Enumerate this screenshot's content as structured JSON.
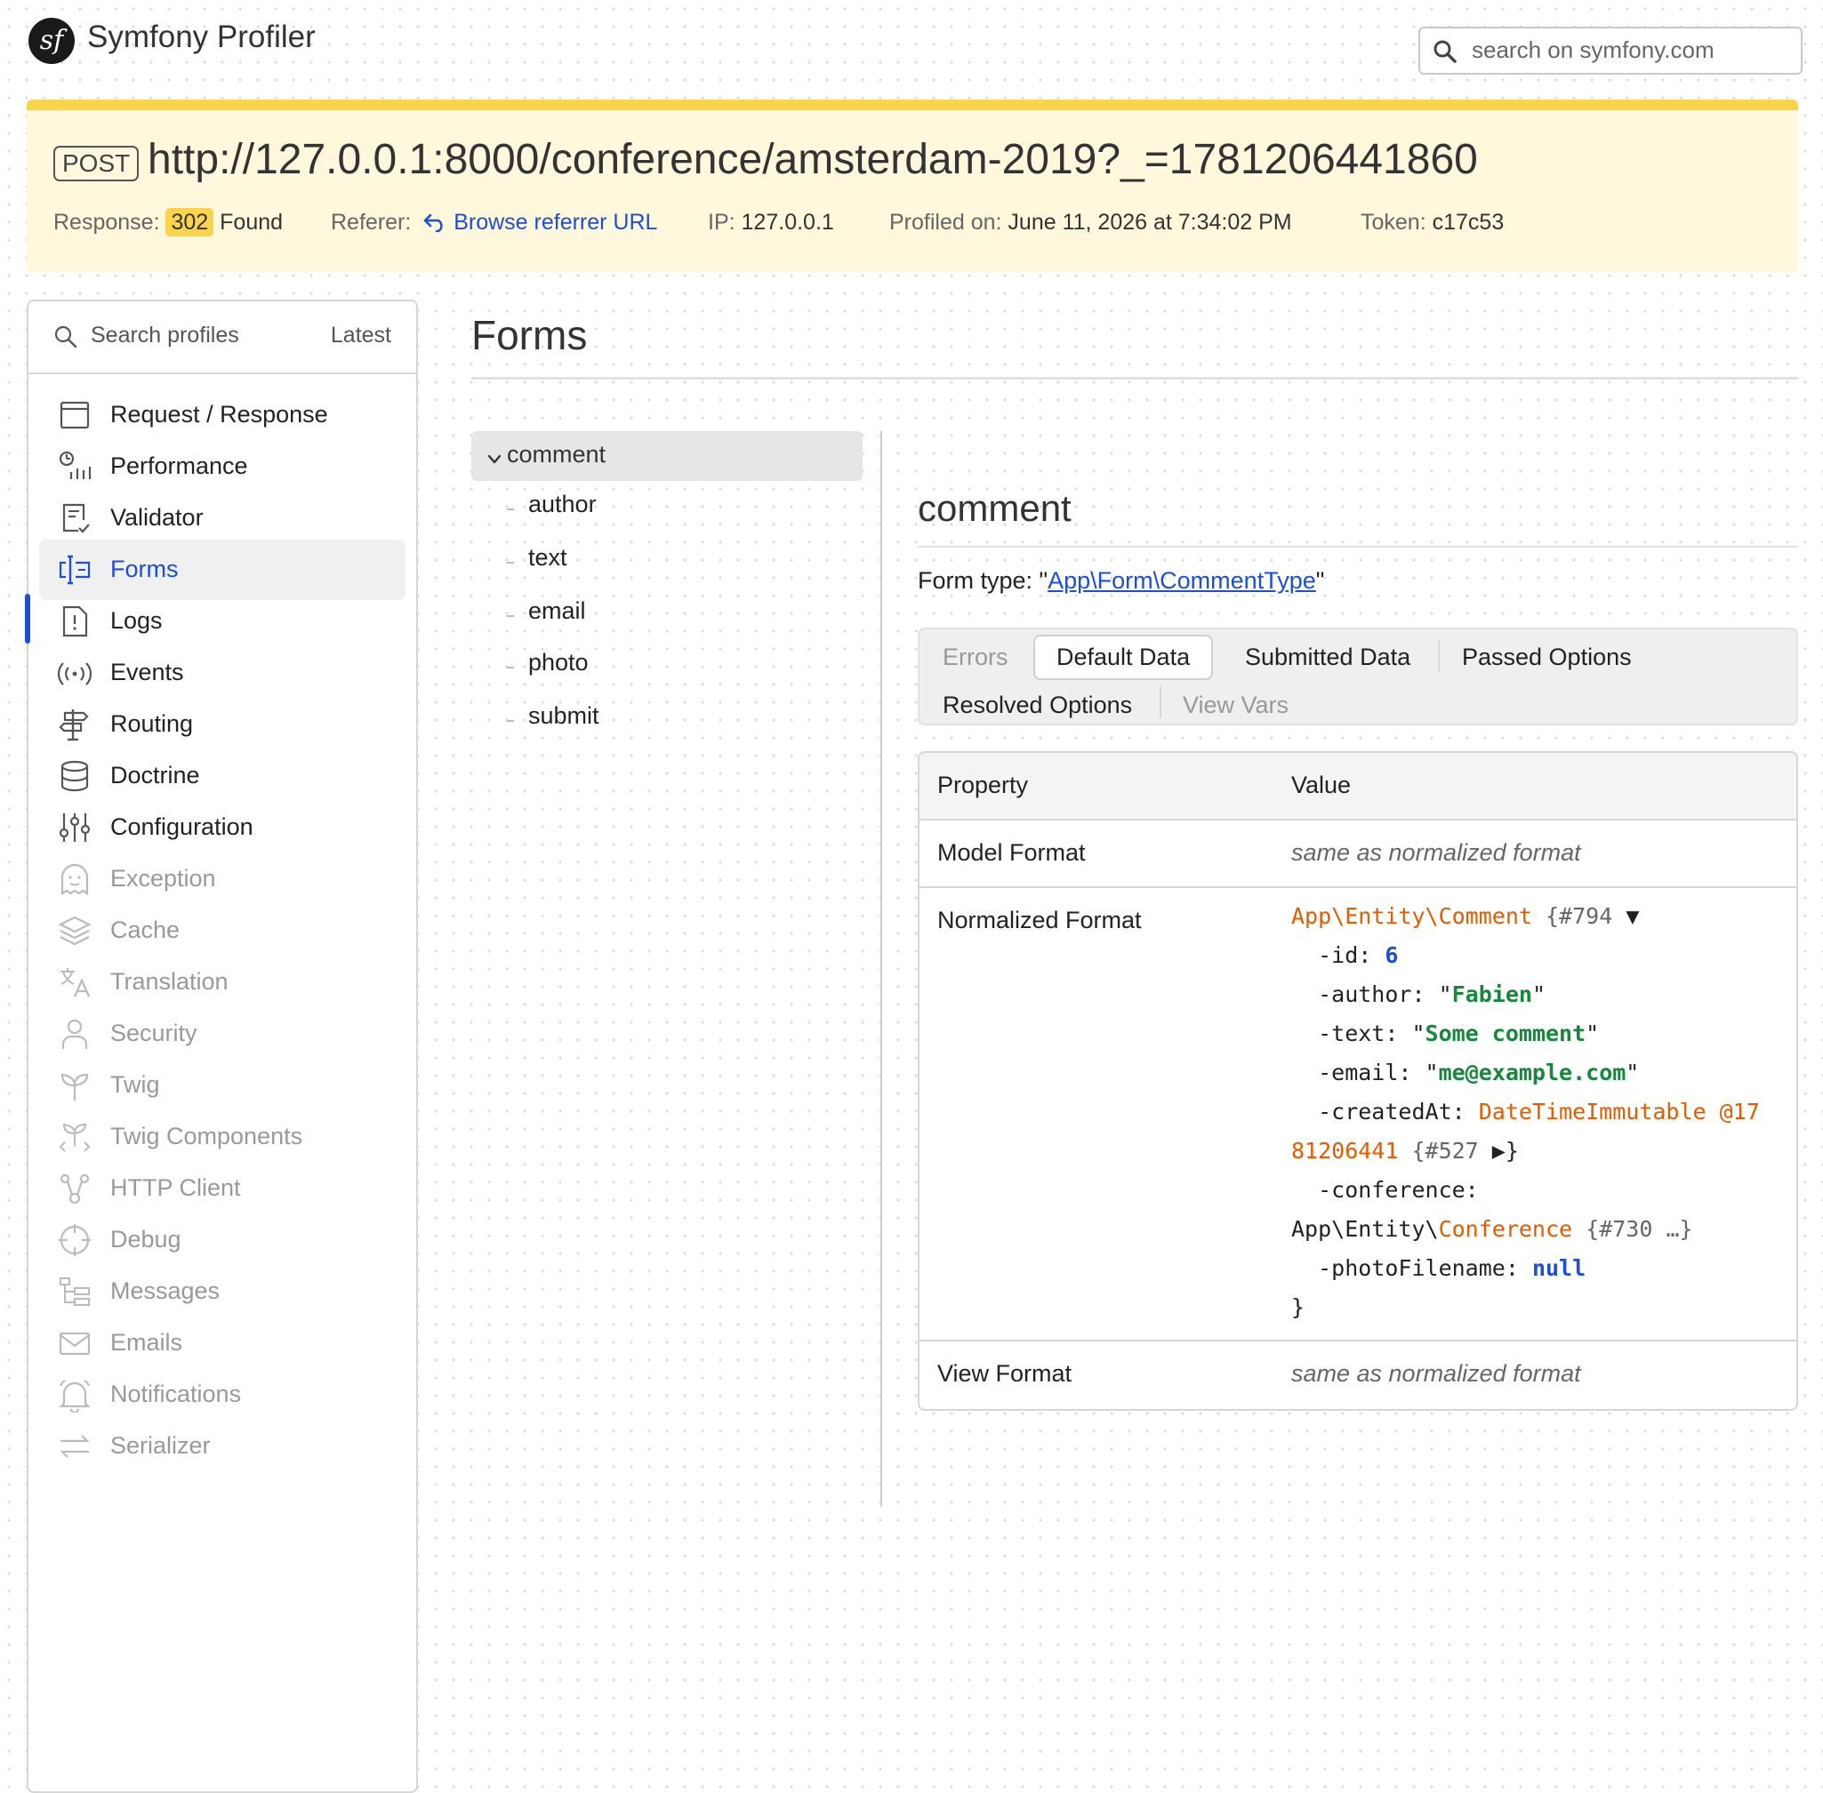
{
  "header": {
    "logo_text": "sf",
    "title": "Symfony Profiler",
    "search_placeholder": "search on symfony.com"
  },
  "summary": {
    "method": "POST",
    "url": "http://127.0.0.1:8000/conference/amsterdam-2019?_=1781206441860",
    "response_label": "Response:",
    "status_code": "302",
    "status_text": "Found",
    "referer_label": "Referer:",
    "referer_link": "Browse referrer URL",
    "ip_label": "IP:",
    "ip_value": "127.0.0.1",
    "profiled_label": "Profiled on:",
    "profiled_value": "June 11, 2026 at 7:34:02 PM",
    "token_label": "Token:",
    "token_value": "c17c53",
    "accent_color": "#fcd34d"
  },
  "sidebar": {
    "search_placeholder": "Search profiles",
    "latest_label": "Latest",
    "items": [
      {
        "label": "Request / Response",
        "icon": "window-icon",
        "state": "enabled"
      },
      {
        "label": "Performance",
        "icon": "performance-icon",
        "state": "enabled"
      },
      {
        "label": "Validator",
        "icon": "validator-icon",
        "state": "enabled"
      },
      {
        "label": "Forms",
        "icon": "forms-icon",
        "state": "active"
      },
      {
        "label": "Logs",
        "icon": "logs-icon",
        "state": "enabled"
      },
      {
        "label": "Events",
        "icon": "events-icon",
        "state": "enabled"
      },
      {
        "label": "Routing",
        "icon": "routing-icon",
        "state": "enabled"
      },
      {
        "label": "Doctrine",
        "icon": "database-icon",
        "state": "enabled"
      },
      {
        "label": "Configuration",
        "icon": "sliders-icon",
        "state": "enabled"
      },
      {
        "label": "Exception",
        "icon": "ghost-icon",
        "state": "disabled"
      },
      {
        "label": "Cache",
        "icon": "layers-icon",
        "state": "disabled"
      },
      {
        "label": "Translation",
        "icon": "translation-icon",
        "state": "disabled"
      },
      {
        "label": "Security",
        "icon": "user-icon",
        "state": "disabled"
      },
      {
        "label": "Twig",
        "icon": "twig-icon",
        "state": "disabled"
      },
      {
        "label": "Twig Components",
        "icon": "twig-components-icon",
        "state": "disabled"
      },
      {
        "label": "HTTP Client",
        "icon": "http-client-icon",
        "state": "disabled"
      },
      {
        "label": "Debug",
        "icon": "debug-icon",
        "state": "disabled"
      },
      {
        "label": "Messages",
        "icon": "messages-icon",
        "state": "disabled"
      },
      {
        "label": "Emails",
        "icon": "mail-icon",
        "state": "disabled"
      },
      {
        "label": "Notifications",
        "icon": "bell-icon",
        "state": "disabled"
      },
      {
        "label": "Serializer",
        "icon": "serializer-icon",
        "state": "disabled"
      }
    ]
  },
  "main": {
    "page_title": "Forms",
    "tree": {
      "root": "comment",
      "children": [
        "author",
        "text",
        "email",
        "photo",
        "submit"
      ]
    },
    "panel": {
      "title": "comment",
      "form_type_label": "Form type: \"",
      "form_type_value": "App\\Form\\CommentType",
      "form_type_suffix": "\"",
      "tabs": [
        {
          "label": "Errors",
          "state": "disabled"
        },
        {
          "label": "Default Data",
          "state": "active"
        },
        {
          "label": "Submitted Data",
          "state": "enabled"
        },
        {
          "label": "Passed Options",
          "state": "enabled"
        },
        {
          "label": "Resolved Options",
          "state": "enabled"
        },
        {
          "label": "View Vars",
          "state": "disabled"
        }
      ],
      "table": {
        "headers": [
          "Property",
          "Value"
        ],
        "rows": [
          {
            "property": "Model Format",
            "value": "same as normalized format"
          },
          {
            "property": "Normalized Format",
            "value": ""
          },
          {
            "property": "View Format",
            "value": "same as normalized format"
          }
        ]
      },
      "dump": {
        "class": "App\\Entity\\Comment",
        "obj_id": "{#794",
        "toggle": "▼",
        "id_key": "  -id: ",
        "id_val": "6",
        "author_key": "  -author: \"",
        "author_val": "Fabien",
        "text_key": "  -text: \"",
        "text_val": "Some comment",
        "email_key": "  -email: \"",
        "email_val": "me@example.com",
        "quote": "\"",
        "created_key": "  -createdAt: ",
        "created_cls_a": "DateTimeImmutable @17",
        "created_cls_b": "81206441",
        "created_ref": " {#527 ",
        "created_toggle": "▶",
        "created_close": "}",
        "conf_key": "  -conference:",
        "conf_ns": "App\\Entity\\",
        "conf_cls": "Conference",
        "conf_ref": " {#730 …}",
        "photo_key": "  -photoFilename: ",
        "photo_val": "null",
        "close": "}"
      }
    }
  }
}
